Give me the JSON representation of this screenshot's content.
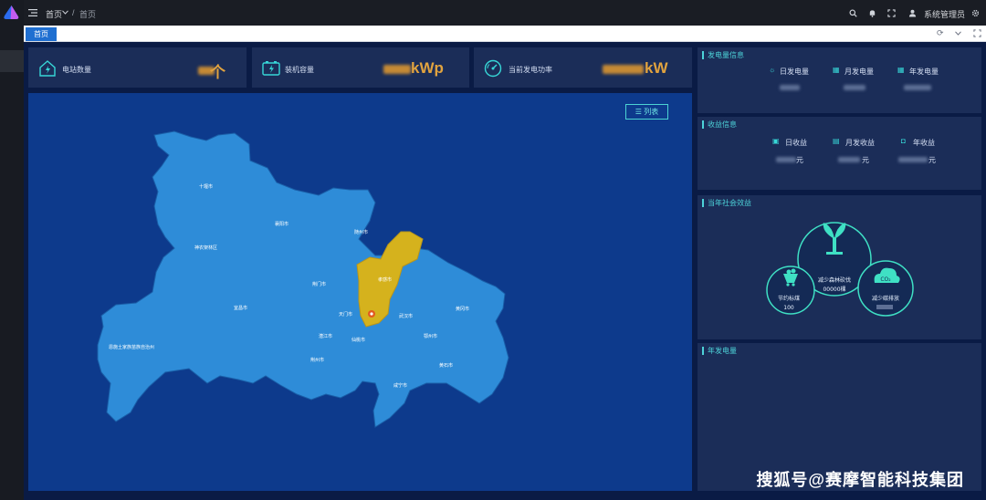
{
  "topbar": {
    "menu_root": "首页",
    "separator": "/",
    "current": "首页",
    "user": "系统管理员"
  },
  "tabs": [
    {
      "label": "首页",
      "active": true
    }
  ],
  "cards": [
    {
      "label": "电站数量",
      "value": "个",
      "icon": "house-lightning-icon"
    },
    {
      "label": "装机容量",
      "value": "kWp",
      "icon": "battery-bolt-icon"
    },
    {
      "label": "当前发电功率",
      "value": "kW",
      "icon": "gauge-icon"
    }
  ],
  "map": {
    "list_button": "列表",
    "highlight_color": "#d5b21d",
    "base_color": "#2e8cd8",
    "cities": [
      "十堰市",
      "襄阳市",
      "随州市",
      "神农架林区",
      "荆门市",
      "宜昌市",
      "孝感市",
      "天门市",
      "武汉市",
      "黄冈市",
      "潜江市",
      "仙桃市",
      "鄂州市",
      "荆州市",
      "黄石市",
      "咸宁市",
      "恩施土家族苗族自治州"
    ]
  },
  "power_panel": {
    "title": "发电量信息",
    "items": [
      {
        "label": "日发电量"
      },
      {
        "label": "月发电量"
      },
      {
        "label": "年发电量"
      }
    ]
  },
  "income_panel": {
    "title": "收益信息",
    "items": [
      {
        "label": "日收益",
        "unit": "元"
      },
      {
        "label": "月发收益",
        "unit": "元"
      },
      {
        "label": "年收益",
        "unit": "元"
      }
    ]
  },
  "social_panel": {
    "title": "当年社会效益",
    "trees_label": "减少森林砍伐",
    "trees_value": "00000棵",
    "coal_label": "节约标煤",
    "coal_value": "100",
    "co2_label": "减少碳排放",
    "co2_badge": "CO₂"
  },
  "annual_panel": {
    "title": "年发电量"
  },
  "watermark": "搜狐号@赛摩智能科技集团"
}
